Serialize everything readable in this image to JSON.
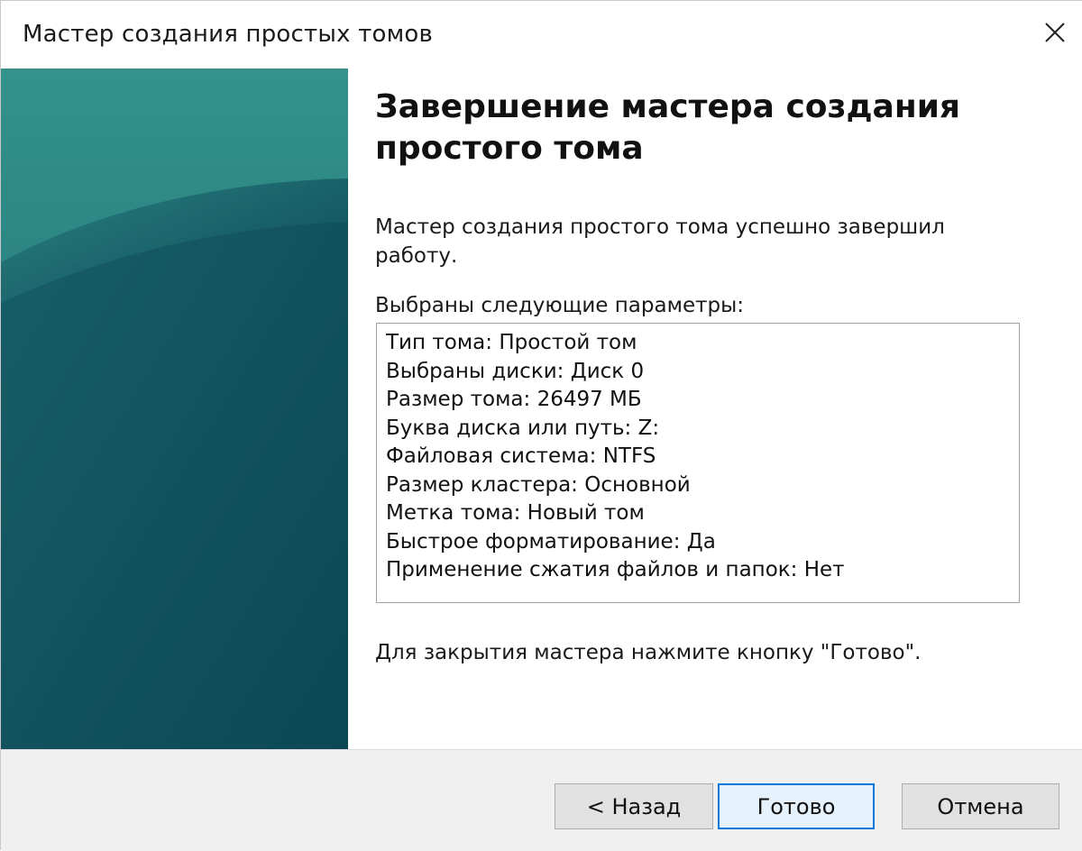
{
  "window": {
    "title": "Мастер создания простых томов",
    "close_icon": "close-icon"
  },
  "content": {
    "heading": "Завершение мастера создания простого тома",
    "description": "Мастер создания простого тома успешно завершил работу.",
    "params_label": "Выбраны следующие параметры:",
    "params": [
      "Тип тома: Простой том",
      "Выбраны диски: Диск 0",
      "Размер тома: 26497 МБ",
      "Буква диска или путь: Z:",
      "Файловая система: NTFS",
      "Размер кластера: Основной",
      "Метка тома: Новый том",
      "Быстрое форматирование: Да",
      "Применение сжатия файлов и папок: Нет"
    ],
    "hint": "Для закрытия мастера нажмите кнопку \"Готово\"."
  },
  "buttons": {
    "back": "< Назад",
    "finish": "Готово",
    "cancel": "Отмена"
  },
  "colors": {
    "sidebar_teal": "#155e6a",
    "focus_border": "#0078d7"
  }
}
